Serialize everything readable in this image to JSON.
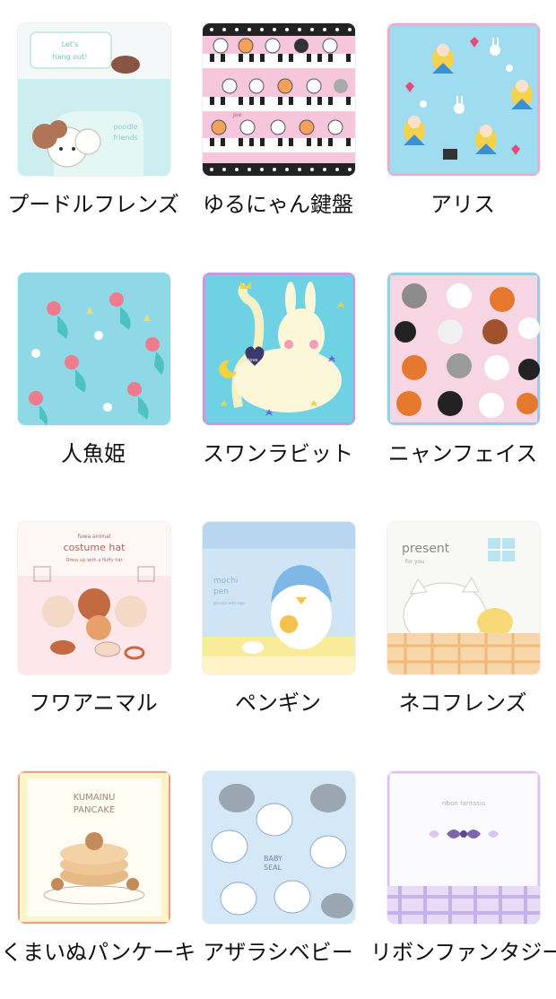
{
  "items": [
    {
      "label": "プードルフレンズ",
      "text": [
        "Let's",
        "hang out!",
        "poodle",
        "friends"
      ]
    },
    {
      "label": "ゆるにゃん鍵盤",
      "text": [
        "Joe"
      ]
    },
    {
      "label": "アリス",
      "text": []
    },
    {
      "label": "人魚姫",
      "text": []
    },
    {
      "label": "スワンラビット",
      "text": [
        "love"
      ]
    },
    {
      "label": "ニャンフェイス",
      "text": []
    },
    {
      "label": "フワアニマル",
      "text": [
        "fuwa animal",
        "costume hat",
        "Dress up with a fluffy hat"
      ]
    },
    {
      "label": "ペンギン",
      "text": [
        "mochi",
        "pen",
        "ghunge with lage"
      ]
    },
    {
      "label": "ネコフレンズ",
      "text": [
        "present",
        "for you"
      ]
    },
    {
      "label": "くまいぬパンケーキ",
      "text": [
        "KUMAINU",
        "PANCAKE"
      ]
    },
    {
      "label": "アザラシベビー",
      "text": [
        "BABY",
        "SEAL"
      ]
    },
    {
      "label": "リボンファンタジー",
      "text": [
        "ribon fantasia"
      ]
    }
  ]
}
